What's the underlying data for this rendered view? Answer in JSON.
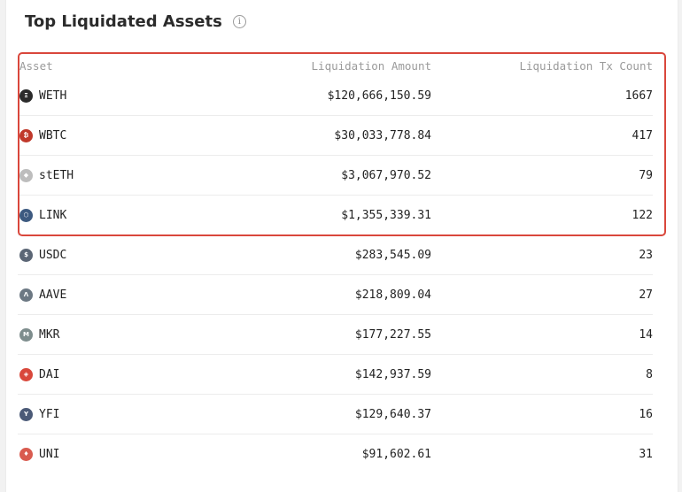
{
  "header": {
    "title": "Top Liquidated Assets"
  },
  "columns": {
    "asset": "Asset",
    "amount": "Liquidation Amount",
    "count": "Liquidation Tx Count"
  },
  "rows": [
    {
      "asset": "WETH",
      "amount": "$120,666,150.59",
      "count": "1667",
      "icon": "weth-icon",
      "color": "#2b2b2b"
    },
    {
      "asset": "WBTC",
      "amount": "$30,033,778.84",
      "count": "417",
      "icon": "wbtc-icon",
      "color": "#c0392b"
    },
    {
      "asset": "stETH",
      "amount": "$3,067,970.52",
      "count": "79",
      "icon": "steth-icon",
      "color": "#bdbdbd"
    },
    {
      "asset": "LINK",
      "amount": "$1,355,339.31",
      "count": "122",
      "icon": "link-icon",
      "color": "#3d5a80"
    },
    {
      "asset": "USDC",
      "amount": "$283,545.09",
      "count": "23",
      "icon": "usdc-icon",
      "color": "#5b6675"
    },
    {
      "asset": "AAVE",
      "amount": "$218,809.04",
      "count": "27",
      "icon": "aave-icon",
      "color": "#6c7883"
    },
    {
      "asset": "MKR",
      "amount": "$177,227.55",
      "count": "14",
      "icon": "mkr-icon",
      "color": "#7e8d8d"
    },
    {
      "asset": "DAI",
      "amount": "$142,937.59",
      "count": "8",
      "icon": "dai-icon",
      "color": "#d9483b"
    },
    {
      "asset": "YFI",
      "amount": "$129,640.37",
      "count": "16",
      "icon": "yfi-icon",
      "color": "#4b5a77"
    },
    {
      "asset": "UNI",
      "amount": "$91,602.61",
      "count": "31",
      "icon": "uni-icon",
      "color": "#d95b4f"
    }
  ],
  "highlight_color": "#d9473c"
}
